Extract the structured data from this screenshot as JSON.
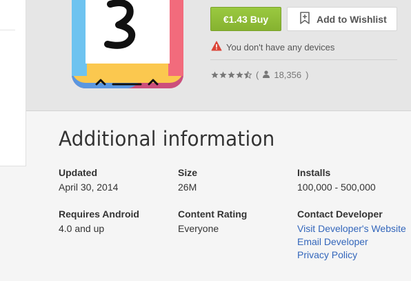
{
  "purchase": {
    "buy_label": "€1.43 Buy",
    "wishlist_label": "Add to Wishlist",
    "warning_text": "You don't have any devices",
    "rating_count": "18,356",
    "rating_stars": 4.5,
    "brand_color": "#8bb937",
    "warning_color": "#db4437"
  },
  "additional": {
    "title": "Additional information",
    "updated": {
      "label": "Updated",
      "value": "April 30, 2014"
    },
    "size": {
      "label": "Size",
      "value": "26M"
    },
    "installs": {
      "label": "Installs",
      "value": "100,000 - 500,000"
    },
    "requires": {
      "label": "Requires Android",
      "value": "4.0 and up"
    },
    "content_rating": {
      "label": "Content Rating",
      "value": "Everyone"
    },
    "contact": {
      "label": "Contact Developer",
      "links": [
        "Visit Developer's Website",
        "Email Developer",
        "Privacy Policy"
      ]
    }
  },
  "icons": [
    "app-icon",
    "wishlist-bookmark-icon",
    "warning-icon",
    "star-icon",
    "person-icon"
  ]
}
